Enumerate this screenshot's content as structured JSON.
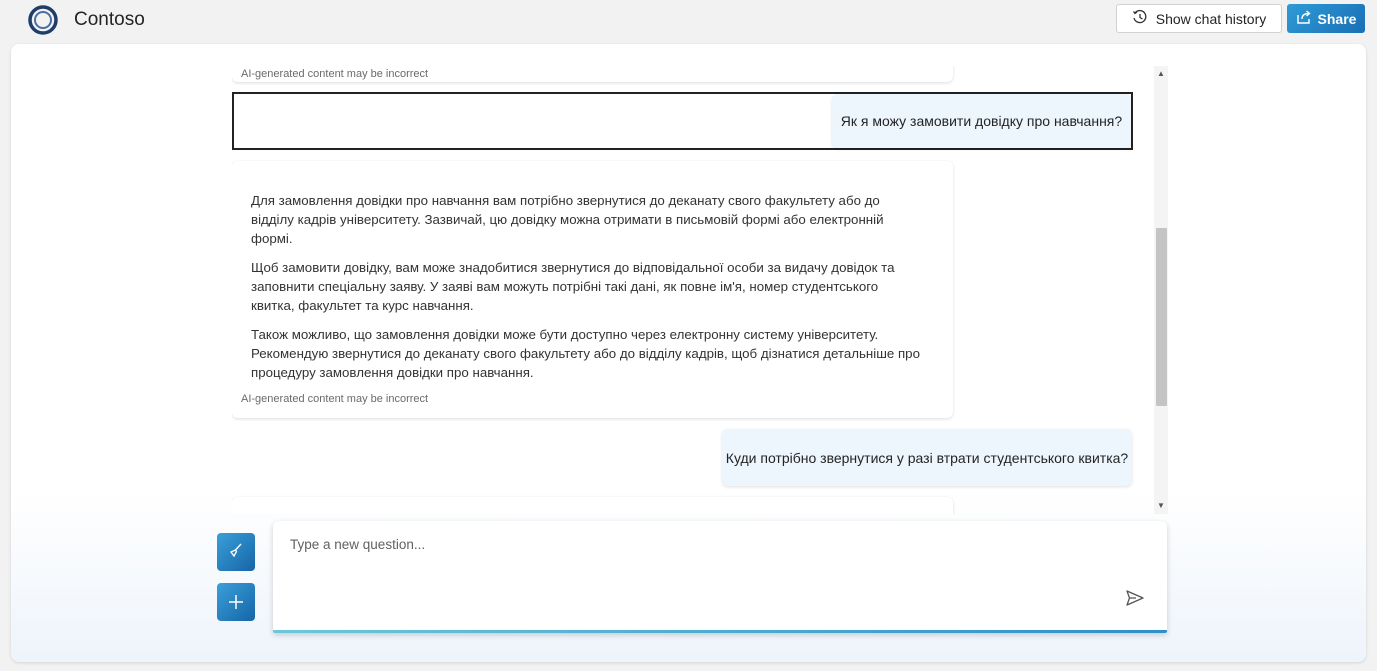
{
  "header": {
    "brand": "Contoso",
    "history_button": "Show chat history",
    "share_button": "Share"
  },
  "chat": {
    "ai_disclaimer": "AI-generated content may be incorrect",
    "user_message_1": "Як я можу замовити довідку про навчання?",
    "answer_1": {
      "paragraphs": [
        "Для замовлення довідки про навчання вам потрібно звернутися до деканату свого факультету або до відділу кадрів університету. Зазвичай, цю довідку можна отримати в письмовій формі або електронній формі.",
        "Щоб замовити довідку, вам може знадобитися звернутися до відповідальної особи за видачу довідок та заповнити спеціальну заяву. У заяві вам можуть потрібні такі дані, як повне ім'я, номер студентського квитка, факультет та курс навчання.",
        "Також можливо, що замовлення довідки може бути доступно через електронну систему університету. Рекомендую звернутися до деканату свого факультету або до відділу кадрів, щоб дізнатися детальніше про процедуру замовлення довідки про навчання."
      ]
    },
    "user_message_2": "Куди потрібно звернутися у разі втрати студентського квитка?"
  },
  "input": {
    "placeholder": "Type a new question..."
  },
  "icons": {
    "logo": "ring-logo-icon",
    "history": "history-clock-icon",
    "share": "share-icon",
    "clear": "broom-icon",
    "new_chat": "plus-icon",
    "send": "send-icon"
  },
  "colors": {
    "accent": "#1a6fb5",
    "user_bubble": "#edf5fd"
  }
}
